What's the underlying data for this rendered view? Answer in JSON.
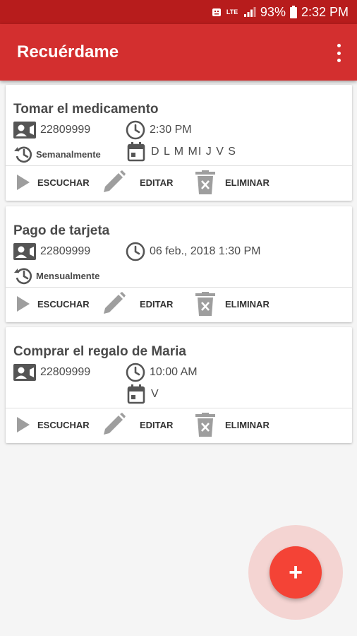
{
  "status_bar": {
    "lte_label": "LTE",
    "battery_percent": "93%",
    "time": "2:32 PM"
  },
  "app_bar": {
    "title": "Recuérdame"
  },
  "colors": {
    "status_bar": "#b71c1c",
    "app_bar": "#d32f2f",
    "fab": "#f44336",
    "icon_gray": "#9e9e9e"
  },
  "reminders": [
    {
      "title": "Tomar el medicamento",
      "phone": "22809999",
      "time": "2:30 PM",
      "repeat": "Semanalmente",
      "days": "D L M MI J V S"
    },
    {
      "title": "Pago de tarjeta",
      "phone": "22809999",
      "time": "06 feb., 2018 1:30 PM",
      "repeat": "Mensualmente"
    },
    {
      "title": "Comprar el regalo de Maria",
      "phone": "22809999",
      "time": "10:00 AM",
      "days": "V"
    }
  ],
  "actions": {
    "listen": "ESCUCHAR",
    "edit": "EDITAR",
    "delete": "ELIMINAR"
  },
  "fab": {
    "label": "+"
  }
}
